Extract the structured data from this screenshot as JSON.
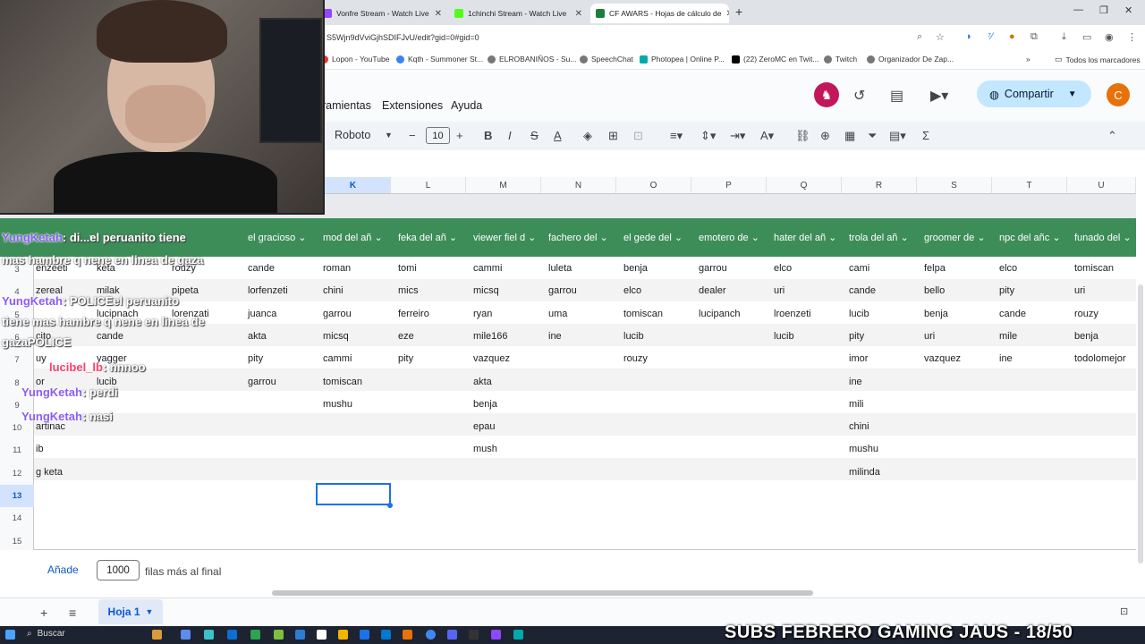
{
  "browser": {
    "tabs": [
      {
        "title": "Vonfre Stream - Watch Live",
        "active": false
      },
      {
        "title": "1chinchi Stream - Watch Live",
        "active": false
      },
      {
        "title": "CF AWARS - Hojas de cálculo de",
        "active": true
      }
    ],
    "url": "S5Wjn9dVviGjhSDIFJvU/edit?gid=0#gid=0",
    "bookmarks": [
      "Lopon - YouTube",
      "Kqth - Summoner St...",
      "ELROBANIÑOS - Su...",
      "SpeechChat",
      "Photopea | Online P...",
      "(22) ZeroMC en Twit...",
      "Twitch",
      "Organizador De Zap...",
      "Todos los marcadores"
    ]
  },
  "menu": [
    "ramientas",
    "Extensiones",
    "Ayuda"
  ],
  "share_label": "Compartir",
  "avatar_letter": "C",
  "toolbar": {
    "font": "Roboto",
    "font_size": "10"
  },
  "columns": [
    "K",
    "L",
    "M",
    "N",
    "O",
    "P",
    "Q",
    "R",
    "S",
    "T",
    "U"
  ],
  "selected_column": "K",
  "header_cells": [
    "el gracioso",
    "mod del añ",
    "feka del añ",
    "viewer fiel d",
    "fachero del",
    "el gede del",
    "emotero de",
    "hater del añ",
    "trola del añ",
    "groomer de",
    "npc del añc",
    "funado del"
  ],
  "rows": [
    {
      "num": "3",
      "cells": [
        "enzeeti",
        "keta",
        "rouzy",
        "cande",
        "roman",
        "tomi",
        "cammi",
        "luleta",
        "benja",
        "garrou",
        "elco",
        "cami",
        "felpa",
        "elco",
        "tomiscan"
      ]
    },
    {
      "num": "4",
      "cells": [
        "zereal",
        "milak",
        "pipeta",
        "lorfenzeti",
        "chini",
        "mics",
        "micsq",
        "garrou",
        "elco",
        "dealer",
        "uri",
        "cande",
        "bello",
        "pity",
        "uri"
      ]
    },
    {
      "num": "5",
      "cells": [
        "",
        "lucipnach",
        "lorenzati",
        "juanca",
        "garrou",
        "ferreiro",
        "ryan",
        "uma",
        "tomiscan",
        "lucipanch",
        "lroenzeti",
        "lucib",
        "benja",
        "cande",
        "rouzy"
      ]
    },
    {
      "num": "6",
      "cells": [
        "cito",
        "cande",
        "",
        "akta",
        "micsq",
        "eze",
        "mile166",
        "ine",
        "lucib",
        "",
        "lucib",
        "pity",
        "uri",
        "mile",
        " benja"
      ]
    },
    {
      "num": "7",
      "cells": [
        "uy",
        "yagger",
        "",
        "pity",
        "cammi",
        "pity",
        "vazquez",
        "",
        "rouzy",
        "",
        "",
        "imor",
        "vazquez",
        "ine",
        "todolomejor"
      ]
    },
    {
      "num": "8",
      "cells": [
        "or",
        "lucib",
        "",
        "garrou",
        "tomiscan",
        "",
        "akta",
        "",
        "",
        "",
        "",
        "ine",
        "",
        "",
        ""
      ]
    },
    {
      "num": "9",
      "cells": [
        "",
        "",
        "",
        "",
        "mushu",
        "",
        "benja",
        "",
        "",
        "",
        "",
        "mili",
        "",
        "",
        ""
      ]
    },
    {
      "num": "10",
      "cells": [
        "artinac",
        "",
        "",
        "",
        "",
        "",
        "epau",
        "",
        "",
        "",
        "",
        "chini",
        "",
        "",
        ""
      ]
    },
    {
      "num": "11",
      "cells": [
        "ib",
        "",
        "",
        "",
        "",
        "",
        "mush",
        "",
        "",
        "",
        "",
        "mushu",
        "",
        "",
        ""
      ]
    },
    {
      "num": "12",
      "cells": [
        "g keta",
        "",
        "",
        "",
        "",
        "",
        "",
        "",
        "",
        "",
        "",
        "milinda",
        "",
        "",
        ""
      ]
    },
    {
      "num": "13",
      "cells": []
    },
    {
      "num": "14",
      "cells": []
    },
    {
      "num": "15",
      "cells": []
    }
  ],
  "add_rows": {
    "button": "Añade",
    "count": "1000",
    "label": "filas más al final"
  },
  "sheet_tab": "Hoja 1",
  "taskbar": {
    "search": "Buscar"
  },
  "overlay_banner": "SUBS FEBRERO GAMING JAUS - 18/50",
  "chat": [
    {
      "user": "YungKetah",
      "msg": ": di...el peruanito tiene"
    },
    {
      "user": "",
      "msg": "mas hambre q nene en linea de gaza"
    },
    {
      "user": "YungKetah",
      "msg": ": POLICEel peruanito"
    },
    {
      "user": "",
      "msg": "tiene mas hambre q nene en linea de"
    },
    {
      "user": "",
      "msg": "gazaPOLICE"
    },
    {
      "user": "lucibel_lb",
      "msg": ": nnnoo"
    },
    {
      "user": "YungKetah",
      "msg": ": perdi"
    },
    {
      "user": "YungKetah",
      "msg": ": nasi"
    }
  ],
  "colors": {
    "header_green": "#3d8d58",
    "accent": "#1a73e8",
    "share_bg": "#c2e7ff"
  }
}
